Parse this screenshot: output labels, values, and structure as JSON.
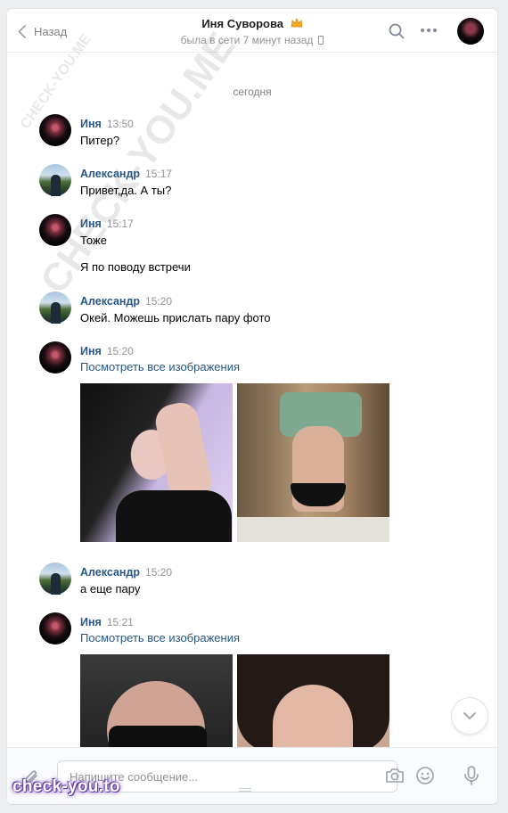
{
  "header": {
    "back_label": "Назад",
    "contact_name": "Иня Суворова",
    "status": "была в сети 7 минут назад"
  },
  "watermarks": [
    "CHECK-YOU.ME",
    "CHECK-YOU.ME"
  ],
  "date_separator": "сегодня",
  "messages": [
    {
      "author": "Иня",
      "time": "13:50",
      "lines": [
        "Питер?"
      ]
    },
    {
      "author": "Александр",
      "time": "15:17",
      "lines": [
        "Привет,да. А ты?"
      ]
    },
    {
      "author": "Иня",
      "time": "15:17",
      "lines": [
        "Тоже",
        "Я по поводу встречи"
      ]
    },
    {
      "author": "Александр",
      "time": "15:20",
      "lines": [
        "Окей. Можешь прислать пару фото"
      ]
    },
    {
      "author": "Иня",
      "time": "15:20",
      "link": "Посмотреть все изображения"
    },
    {
      "author": "Александр",
      "time": "15:20",
      "lines": [
        "а еще пару"
      ]
    },
    {
      "author": "Иня",
      "time": "15:21",
      "link": "Посмотреть все изображения"
    }
  ],
  "composer": {
    "placeholder": "Напишите сообщение..."
  },
  "brand_watermark": "check-you.to",
  "icons": [
    "chevron-left-icon",
    "crown-emoji-icon",
    "phone-icon",
    "search-icon",
    "more-icon",
    "chevron-down-icon",
    "paperclip-icon",
    "camera-icon",
    "smile-icon",
    "microphone-icon"
  ],
  "colors": {
    "link": "#2a5885",
    "muted": "#939393",
    "background": "#edeef0",
    "panel": "#ffffff"
  }
}
